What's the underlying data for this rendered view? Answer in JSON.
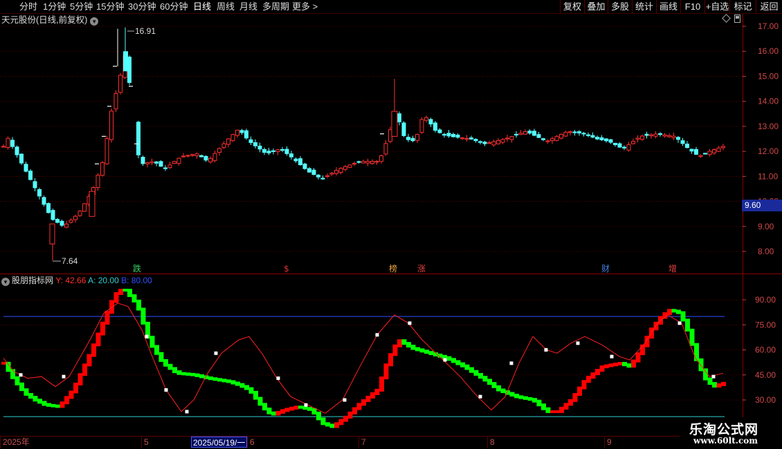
{
  "toolbar": {
    "periods": [
      "分时",
      "1分钟",
      "5分钟",
      "15分钟",
      "30分钟",
      "60分钟",
      "日线",
      "周线",
      "月线",
      "多周期",
      "更多 >"
    ],
    "active_period": "日线",
    "right": [
      "复权",
      "叠加",
      "多股",
      "统计",
      "画线",
      "F10",
      "+自选",
      "标记",
      "返回"
    ]
  },
  "main_chart": {
    "title": "天元股份(日线,前复权)",
    "price_ticks": [
      "17.00",
      "16.00",
      "15.00",
      "14.00",
      "13.00",
      "12.00",
      "11.00",
      "10.00",
      "9.00",
      "8.00"
    ],
    "current_price": "9.60",
    "high_label": "16.91",
    "low_label": "7.64",
    "event_markers": [
      {
        "text": "跌",
        "color": "#30d060"
      },
      {
        "text": "$",
        "color": "#e03030"
      },
      {
        "text": "榜",
        "color": "#e8a040"
      },
      {
        "text": "涨",
        "color": "#e04040"
      },
      {
        "text": "财",
        "color": "#4080e0"
      },
      {
        "text": "增",
        "color": "#e04040"
      }
    ]
  },
  "indicator": {
    "name": "股朋指标网",
    "y_label": "Y: 42.66",
    "a_label": "A: 20.00",
    "b_label": "B: 80.00",
    "y_color": "#ff3030",
    "a_color": "#30d0d0",
    "b_color": "#3050ff",
    "ticks": [
      "90.00",
      "75.00",
      "60.00",
      "45.00",
      "30.00"
    ],
    "a_level": 20,
    "b_level": 80
  },
  "dates": {
    "labels": [
      "2025年",
      "5",
      "6",
      "7",
      "8",
      "9"
    ],
    "cursor": "2025/05/19/一"
  },
  "watermark": {
    "name": "乐淘公式网",
    "url": "www.60lt.com"
  },
  "colors": {
    "up": "#ff3030",
    "down": "#54ffff",
    "green_bar": "#00ff00",
    "red_bar": "#ff0000",
    "grid": "#7a0000"
  },
  "icons": [
    "dropdown-icon",
    "expand-icon",
    "scroll-icon"
  ]
}
